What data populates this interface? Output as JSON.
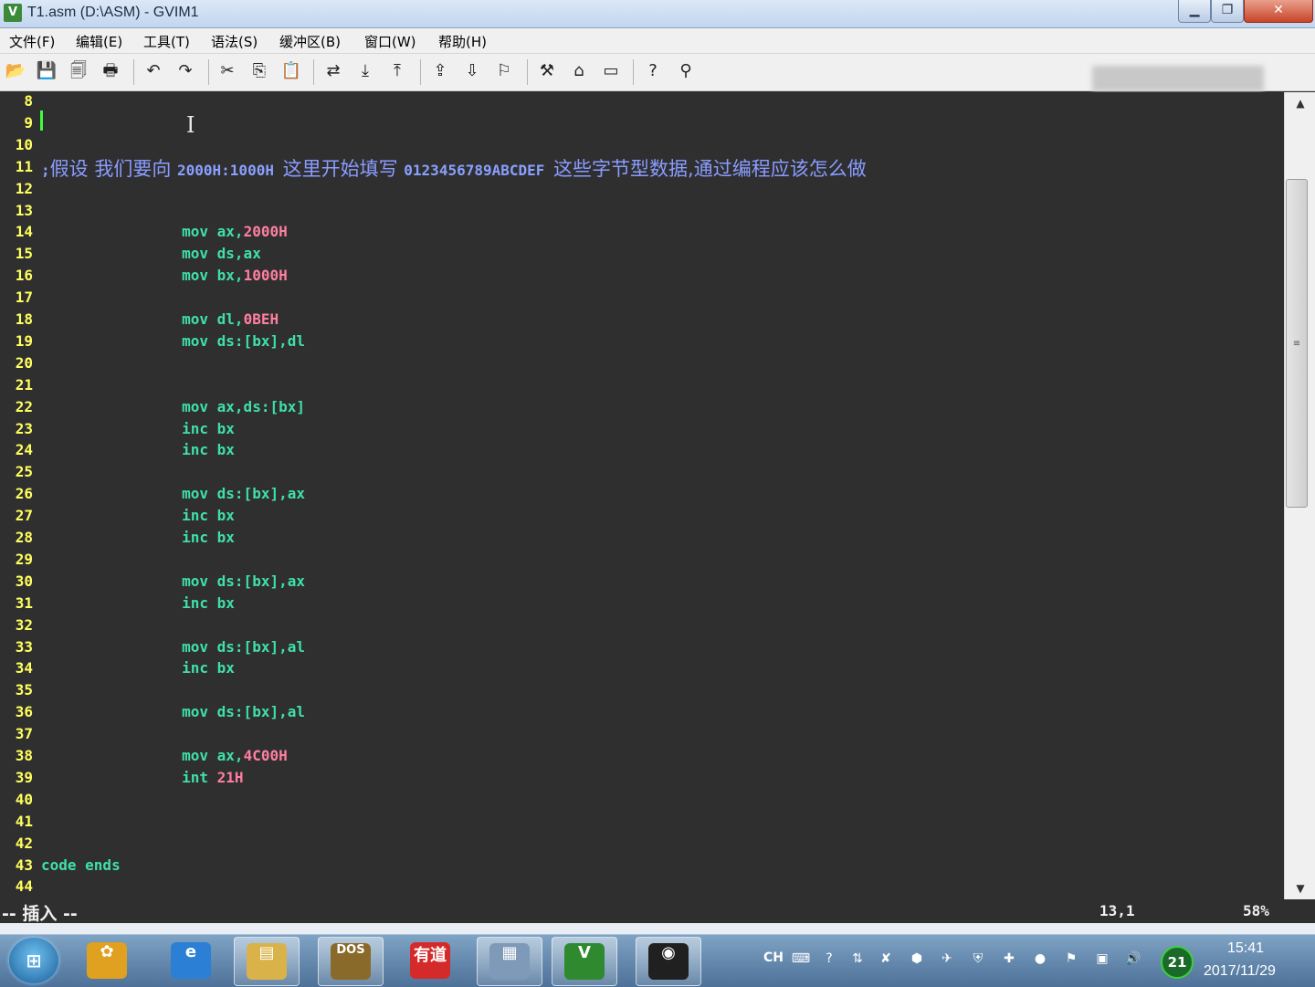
{
  "window": {
    "title": "T1.asm (D:\\ASM) - GVIM1",
    "app_icon": "vim-icon",
    "controls": {
      "minimize": "▁",
      "maximize": "❐",
      "close": "✕"
    }
  },
  "menu": [
    "文件(F)",
    "编辑(E)",
    "工具(T)",
    "语法(S)",
    "缓冲区(B)",
    "窗口(W)",
    "帮助(H)"
  ],
  "toolbar": [
    {
      "icon": "open-icon",
      "glyph": "📂"
    },
    {
      "icon": "save-icon",
      "glyph": "💾"
    },
    {
      "icon": "save-all-icon",
      "glyph": "🗐"
    },
    {
      "icon": "print-icon",
      "glyph": "🖶"
    },
    {
      "icon": "undo-icon",
      "glyph": "↶"
    },
    {
      "icon": "redo-icon",
      "glyph": "↷"
    },
    {
      "icon": "cut-icon",
      "glyph": "✂"
    },
    {
      "icon": "copy-icon",
      "glyph": "⎘"
    },
    {
      "icon": "paste-icon",
      "glyph": "📋"
    },
    {
      "icon": "replace-icon",
      "glyph": "⇄"
    },
    {
      "icon": "find-next-icon",
      "glyph": "⤓"
    },
    {
      "icon": "find-prev-icon",
      "glyph": "⤒"
    },
    {
      "icon": "load-session-icon",
      "glyph": "⇪"
    },
    {
      "icon": "save-session-icon",
      "glyph": "⇩"
    },
    {
      "icon": "run-script-icon",
      "glyph": "⚐"
    },
    {
      "icon": "make-icon",
      "glyph": "⚒"
    },
    {
      "icon": "shell-icon",
      "glyph": "⌂"
    },
    {
      "icon": "tags-icon",
      "glyph": "▭"
    },
    {
      "icon": "help-icon",
      "glyph": "?"
    },
    {
      "icon": "find-help-icon",
      "glyph": "⚲"
    }
  ],
  "editor": {
    "lines": [
      {
        "n": "8",
        "segs": []
      },
      {
        "n": "9",
        "segs": []
      },
      {
        "n": "10",
        "segs": []
      },
      {
        "n": "11",
        "segs": [
          {
            "t": ";",
            "c": "cmt"
          },
          {
            "t": "假设 我们要向 ",
            "c": "cmtzh"
          },
          {
            "t": "2000H:1000H ",
            "c": "cmt"
          },
          {
            "t": "这里开始填写 ",
            "c": "cmtzh"
          },
          {
            "t": "0123456789ABCDEF ",
            "c": "cmt"
          },
          {
            "t": "这些字节型数据,通过编程应该怎么做",
            "c": "cmtzh"
          }
        ]
      },
      {
        "n": "12",
        "segs": []
      },
      {
        "n": "13",
        "segs": []
      },
      {
        "n": "14",
        "segs": [
          {
            "t": "                mov ax,",
            "c": "kw"
          },
          {
            "t": "2000H",
            "c": "num"
          }
        ]
      },
      {
        "n": "15",
        "segs": [
          {
            "t": "                mov ds,ax",
            "c": "kw"
          }
        ]
      },
      {
        "n": "16",
        "segs": [
          {
            "t": "                mov bx,",
            "c": "kw"
          },
          {
            "t": "1000H",
            "c": "num"
          }
        ]
      },
      {
        "n": "17",
        "segs": []
      },
      {
        "n": "18",
        "segs": [
          {
            "t": "                mov dl,",
            "c": "kw"
          },
          {
            "t": "0BEH",
            "c": "num"
          }
        ]
      },
      {
        "n": "19",
        "segs": [
          {
            "t": "                mov ds:[bx],dl",
            "c": "kw"
          }
        ]
      },
      {
        "n": "20",
        "segs": []
      },
      {
        "n": "21",
        "segs": []
      },
      {
        "n": "22",
        "segs": [
          {
            "t": "                mov ax,ds:[bx]",
            "c": "kw"
          }
        ]
      },
      {
        "n": "23",
        "segs": [
          {
            "t": "                inc bx",
            "c": "kw"
          }
        ]
      },
      {
        "n": "24",
        "segs": [
          {
            "t": "                inc bx",
            "c": "kw"
          }
        ]
      },
      {
        "n": "25",
        "segs": []
      },
      {
        "n": "26",
        "segs": [
          {
            "t": "                mov ds:[bx],ax",
            "c": "kw"
          }
        ]
      },
      {
        "n": "27",
        "segs": [
          {
            "t": "                inc bx",
            "c": "kw"
          }
        ]
      },
      {
        "n": "28",
        "segs": [
          {
            "t": "                inc bx",
            "c": "kw"
          }
        ]
      },
      {
        "n": "29",
        "segs": []
      },
      {
        "n": "30",
        "segs": [
          {
            "t": "                mov ds:[bx],ax",
            "c": "kw"
          }
        ]
      },
      {
        "n": "31",
        "segs": [
          {
            "t": "                inc bx",
            "c": "kw"
          }
        ]
      },
      {
        "n": "32",
        "segs": []
      },
      {
        "n": "33",
        "segs": [
          {
            "t": "                mov ds:[bx],al",
            "c": "kw"
          }
        ]
      },
      {
        "n": "34",
        "segs": [
          {
            "t": "                inc bx",
            "c": "kw"
          }
        ]
      },
      {
        "n": "35",
        "segs": []
      },
      {
        "n": "36",
        "segs": [
          {
            "t": "                mov ds:[bx],al",
            "c": "kw"
          }
        ]
      },
      {
        "n": "37",
        "segs": []
      },
      {
        "n": "38",
        "segs": [
          {
            "t": "                mov ax,",
            "c": "kw"
          },
          {
            "t": "4C00H",
            "c": "num"
          }
        ]
      },
      {
        "n": "39",
        "segs": [
          {
            "t": "                int ",
            "c": "kw"
          },
          {
            "t": "21H",
            "c": "num"
          }
        ]
      },
      {
        "n": "40",
        "segs": []
      },
      {
        "n": "41",
        "segs": []
      },
      {
        "n": "42",
        "segs": []
      },
      {
        "n": "43",
        "segs": [
          {
            "t": "code ends",
            "c": "kw"
          }
        ]
      },
      {
        "n": "44",
        "segs": []
      }
    ],
    "colors": {
      "line_number": "#ffff5f",
      "keyword": "#3fe0a8",
      "number": "#ff7fa0",
      "comment": "#8aa0ff",
      "background": "#2f2f2f",
      "cursor": "#3cff3c"
    },
    "scroll_fraction": 0.58
  },
  "status": {
    "mode": "-- 插入 --",
    "position": "13,1",
    "percent": "58%"
  },
  "taskbar": {
    "apps": [
      {
        "name": "start-button",
        "glyph": "⊞"
      },
      {
        "name": "colorful-app-icon",
        "glyph": "✿",
        "bg": "#e0a020"
      },
      {
        "name": "internet-explorer-icon",
        "glyph": "e",
        "bg": "#2b7fd4"
      },
      {
        "name": "file-explorer-icon",
        "glyph": "▤",
        "bg": "#d9b24a"
      },
      {
        "name": "dosbox-icon",
        "glyph": "DOS",
        "bg": "#8a6a2a"
      },
      {
        "name": "youdao-dictionary-icon",
        "glyph": "有道",
        "bg": "#d42a2a"
      },
      {
        "name": "calculator-icon",
        "glyph": "▦",
        "bg": "#7f9ab8"
      },
      {
        "name": "gvim-icon",
        "glyph": "V",
        "bg": "#2f8a2f"
      },
      {
        "name": "obs-icon",
        "glyph": "◉",
        "bg": "#202020"
      }
    ],
    "tray_lang": "CH",
    "tray_icons": [
      "keyboard-icon",
      "help-icon",
      "network-arrows-icon",
      "kingsoft-icon",
      "shield-green-icon",
      "satellite-icon",
      "security-shield-icon",
      "plus-green-icon",
      "red-app-icon",
      "flag-icon",
      "network-icon",
      "volume-icon"
    ],
    "badge": "21",
    "time": "15:41",
    "date": "2017/11/29"
  }
}
